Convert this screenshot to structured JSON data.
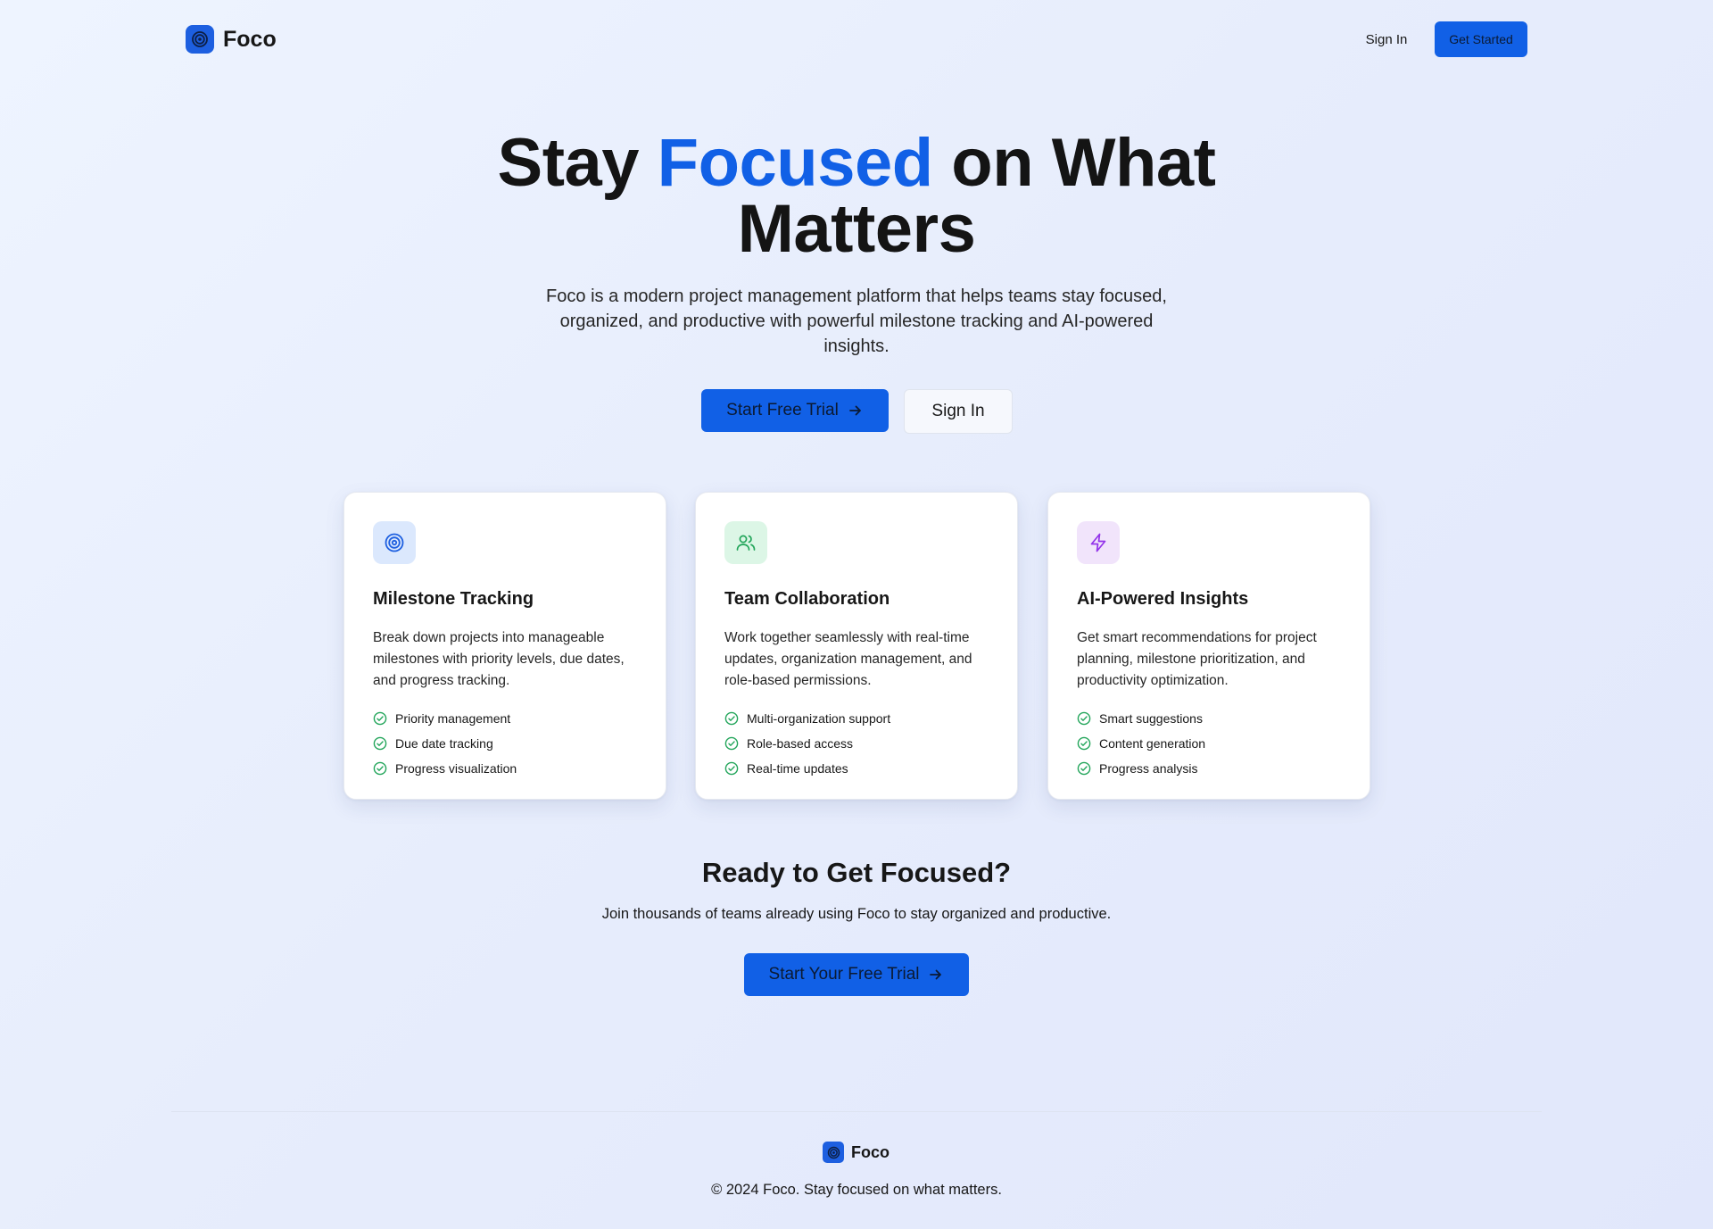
{
  "nav": {
    "brand": "Foco",
    "sign_in": "Sign In",
    "get_started": "Get Started"
  },
  "hero": {
    "title_part1": "Stay ",
    "title_accent": "Focused",
    "title_part2": " on What Matters",
    "subtitle": "Foco is a modern project management platform that helps teams stay focused, organized, and productive with powerful milestone tracking and AI-powered insights.",
    "primary_cta": "Start Free Trial",
    "secondary_cta": "Sign In"
  },
  "features": [
    {
      "icon": "target-icon",
      "title": "Milestone Tracking",
      "description": "Break down projects into manageable milestones with priority levels, due dates, and progress tracking.",
      "items": [
        "Priority management",
        "Due date tracking",
        "Progress visualization"
      ]
    },
    {
      "icon": "users-icon",
      "title": "Team Collaboration",
      "description": "Work together seamlessly with real-time updates, organization management, and role-based permissions.",
      "items": [
        "Multi-organization support",
        "Role-based access",
        "Real-time updates"
      ]
    },
    {
      "icon": "lightning-icon",
      "title": "AI-Powered Insights",
      "description": "Get smart recommendations for project planning, milestone prioritization, and productivity optimization.",
      "items": [
        "Smart suggestions",
        "Content generation",
        "Progress analysis"
      ]
    }
  ],
  "cta": {
    "title": "Ready to Get Focused?",
    "subtitle": "Join thousands of teams already using Foco to stay organized and productive.",
    "button": "Start Your Free Trial"
  },
  "footer": {
    "brand": "Foco",
    "copyright": "© 2024 Foco. Stay focused on what matters."
  },
  "colors": {
    "accent": "#1160e6",
    "check": "#22a55a",
    "milestone_bg": "#dbe8fd",
    "collab_bg": "#dcf6e6",
    "ai_bg": "#f1e4fb"
  }
}
